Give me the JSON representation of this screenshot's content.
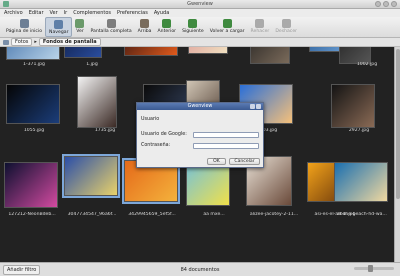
{
  "window": {
    "title": "Gwenview"
  },
  "menu": [
    "Archivo",
    "Editar",
    "Ver",
    "Ir",
    "Complementos",
    "Preferencias",
    "Ayuda"
  ],
  "toolbar": [
    {
      "label": "Página de inicio",
      "icon": "home-icon",
      "color": "#6d7f95"
    },
    {
      "label": "Navegar",
      "icon": "grid-icon",
      "color": "#5e7fa8",
      "active": true
    },
    {
      "label": "Ver",
      "icon": "image-icon",
      "color": "#6b9a6a"
    },
    {
      "label": "Pantalla completa",
      "icon": "fullscreen-icon",
      "color": "#7d7d7d"
    },
    {
      "label": "Arriba",
      "icon": "up-arrow-icon",
      "color": "#7a6c5c"
    },
    {
      "label": "Anterior",
      "icon": "left-arrow-icon",
      "color": "#3f8a3f"
    },
    {
      "label": "Siguiente",
      "icon": "right-arrow-icon",
      "color": "#3f8a3f"
    },
    {
      "label": "Volver a cargar",
      "icon": "reload-icon",
      "color": "#3f8a3f"
    },
    {
      "label": "Rehacer",
      "icon": "redo-icon",
      "color": "#aaaaaa",
      "disabled": true
    },
    {
      "label": "Deshacer",
      "icon": "undo-icon",
      "color": "#aaaaaa",
      "disabled": true
    }
  ],
  "breadcrumb": {
    "root": "Fotos",
    "current": "Fondos de pantalla"
  },
  "thumbnails": [
    {
      "caption": "1-371.jpg",
      "c1": "#3f6fa8",
      "c2": "#b9d3e8"
    },
    {
      "caption": "1.jpg",
      "c1": "#0c1a40",
      "c2": "#2a4d9e"
    },
    {
      "caption": "",
      "c1": "#2a1010",
      "c2": "#e05a1c"
    },
    {
      "caption": "",
      "c1": "#d98b8f",
      "c2": "#f0e0c0"
    },
    {
      "caption": "",
      "c1": "#1b1b1b",
      "c2": "#7a6a5a"
    },
    {
      "caption": "",
      "c1": "#1d4f8a",
      "c2": "#6fa3d8"
    },
    {
      "caption": "1002.jpg",
      "c1": "#1a1a1a",
      "c2": "#555555"
    },
    {
      "caption": "1055.jpg",
      "c1": "#050505",
      "c2": "#1b3d7a"
    },
    {
      "caption": "1735.jpg",
      "c1": "#f3f3f3",
      "c2": "#3b2a25"
    },
    {
      "caption": "2042.jpg",
      "c1": "#0a0a0a",
      "c2": "#3a4a6a"
    },
    {
      "caption": "2100.jpg",
      "c1": "#d0c5b5",
      "c2": "#4d3b30"
    },
    {
      "caption": "2103.jpg",
      "c1": "#2a6fd8",
      "c2": "#f5c07a"
    },
    {
      "caption": "2927.jpg",
      "c1": "#141414",
      "c2": "#8a6a55"
    },
    {
      "caption": "127212-NeonBdeb...",
      "c1": "#0d1030",
      "c2": "#d24aa0"
    },
    {
      "caption": "3047734547_96a6f...",
      "c1": "#2b4fa8",
      "c2": "#e9d26a"
    },
    {
      "caption": "3429945659_5ef5f...",
      "c1": "#e56a1a",
      "c2": "#f4b23c"
    },
    {
      "caption": "aa mxe...",
      "c1": "#6fc0e0",
      "c2": "#f0e04a"
    },
    {
      "caption": "alizee-jacotey-2-11...",
      "c1": "#e8e0d5",
      "c2": "#6a4a3a"
    },
    {
      "caption": "asi-es-el-amor.jpg",
      "c1": "#f2a21a",
      "c2": "#5a2a0a"
    },
    {
      "caption": "at-the-beach-hd-wa...",
      "c1": "#1a6fb0",
      "c2": "#f0d8a0"
    }
  ],
  "dialog": {
    "title": "Gwenview",
    "section_label": "Usuario",
    "user_label": "Usuario de Google:",
    "user_value": "",
    "password_label": "Contraseña:",
    "password_value": "",
    "ok_label": "OK",
    "cancel_label": "Cancelar"
  },
  "status": {
    "filter_label": "Añadir filtro",
    "count_text": "84 documentos"
  }
}
